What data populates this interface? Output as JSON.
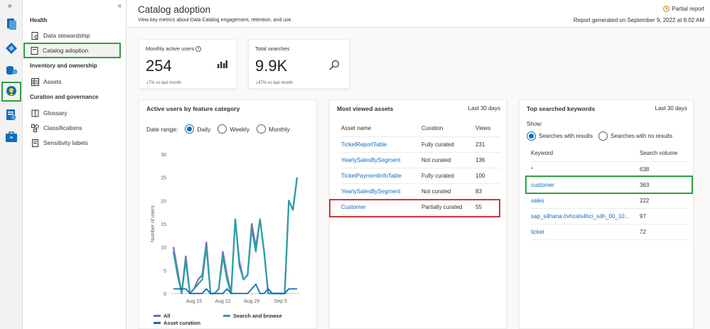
{
  "rail": {
    "toggle": "»"
  },
  "nav": {
    "collapse": "«",
    "sections": [
      {
        "heading": "Health"
      },
      {
        "heading": "Inventory and ownership"
      },
      {
        "heading": "Curation and governance"
      }
    ],
    "items": [
      {
        "label": "Data stewardship"
      },
      {
        "label": "Catalog adoption"
      },
      {
        "label": "Assets"
      },
      {
        "label": "Glossary"
      },
      {
        "label": "Classifications"
      },
      {
        "label": "Sensitivity labels"
      }
    ]
  },
  "header": {
    "title": "Catalog adoption",
    "subtitle": "View key metrics about Data Catalog engagement, retention, and use.",
    "partial": "Partial report",
    "generated": "Report generated on September 9, 2022 at 8:02 AM"
  },
  "kpis": [
    {
      "label": "Monthly active users",
      "value": "254",
      "delta": "7% vs last month"
    },
    {
      "label": "Total searches",
      "value": "9.9K",
      "delta": "47% vs last month"
    }
  ],
  "active_users": {
    "title": "Active users by feature category",
    "date_range_label": "Date range:",
    "options": [
      "Daily",
      "Weekly",
      "Monthly"
    ],
    "selected": "Daily",
    "legend": [
      "All",
      "Search and browse",
      "Asset curation"
    ]
  },
  "chart_data": {
    "type": "line",
    "title": "",
    "xlabel": "",
    "ylabel": "Number of users",
    "ylim": [
      0,
      30
    ],
    "yticks": [
      0,
      5,
      10,
      15,
      20,
      25,
      30
    ],
    "xtick_labels": [
      "Aug 15",
      "Aug 22",
      "Aug 29",
      "Sep 5"
    ],
    "xtick_index": [
      5,
      12,
      19,
      26
    ],
    "x_count": 31,
    "series": [
      {
        "name": "All",
        "color": "#8764b8",
        "values": [
          10,
          5,
          0,
          8,
          0,
          1,
          3,
          4,
          11,
          0,
          0,
          1,
          9,
          4,
          0,
          16,
          7,
          3,
          4,
          15,
          10,
          16,
          9,
          0,
          0,
          0,
          0,
          0,
          20,
          18,
          25
        ]
      },
      {
        "name": "Search and browse",
        "color": "#2aa0a4",
        "values": [
          9,
          4,
          0,
          7,
          0,
          1,
          2,
          3,
          10,
          0,
          0,
          1,
          8,
          3,
          0,
          16,
          6,
          3,
          4,
          14,
          9,
          16,
          9,
          0,
          0,
          0,
          0,
          0,
          20,
          18,
          25
        ]
      },
      {
        "name": "Asset curation",
        "color": "#0f6cbd",
        "values": [
          1,
          1,
          1,
          1,
          0,
          0,
          0,
          0,
          1,
          0,
          0,
          0,
          0,
          1,
          0,
          0,
          0,
          0,
          0,
          1,
          2,
          0,
          0,
          1,
          0,
          0,
          0,
          0,
          1,
          1,
          1
        ]
      }
    ]
  },
  "most_viewed": {
    "title": "Most viewed assets",
    "period": "Last 30 days",
    "columns": [
      "Asset name",
      "Curation",
      "Views"
    ],
    "rows": [
      [
        "TicketReportTable",
        "Fully curated",
        "231"
      ],
      [
        "YearlySalesBySegment",
        "Not curated",
        "136"
      ],
      [
        "TicketPaymentInfoTable",
        "Fully curated",
        "100"
      ],
      [
        "YearlySalesBySegment",
        "Not curated",
        "83"
      ],
      [
        "Customer",
        "Partially curated",
        "55"
      ]
    ]
  },
  "top_keywords": {
    "title": "Top searched keywords",
    "period": "Last 30 days",
    "show_label": "Show:",
    "options": [
      "Searches with results",
      "Searches with no results"
    ],
    "selected": "Searches with results",
    "columns": [
      "Keyword",
      "Search volume"
    ],
    "rows": [
      [
        "*",
        "638"
      ],
      [
        "customer",
        "363"
      ],
      [
        "sales",
        "222"
      ],
      [
        "sap_s4hana://vhcals4hci_s4h_00_10...",
        "97"
      ],
      [
        "ticket",
        "72"
      ]
    ]
  }
}
